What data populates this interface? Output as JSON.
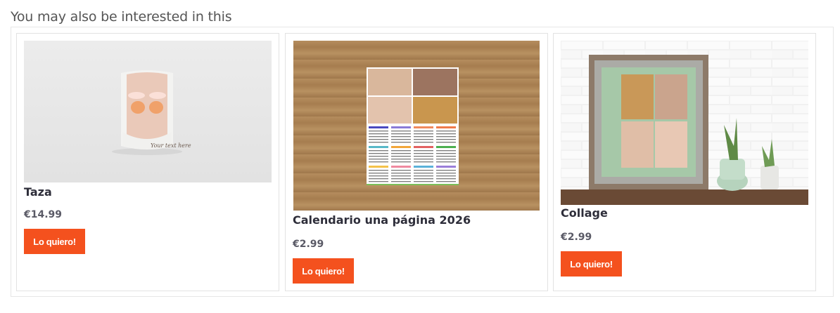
{
  "section": {
    "title": "You may also be interested in this"
  },
  "products": [
    {
      "name": "Taza",
      "price": "€14.99",
      "button": "Lo quiero!",
      "image_icon": "mug-product-image",
      "mug_text": "Your text here"
    },
    {
      "name": "Calendario una página 2026",
      "price": "€2.99",
      "button": "Lo quiero!",
      "image_icon": "calendar-product-image"
    },
    {
      "name": "Collage",
      "price": "€2.99",
      "button": "Lo quiero!",
      "image_icon": "collage-frame-product-image"
    }
  ],
  "colors": {
    "button_bg": "#f4511e",
    "button_text": "#ffffff",
    "border": "#e2e2e2"
  }
}
